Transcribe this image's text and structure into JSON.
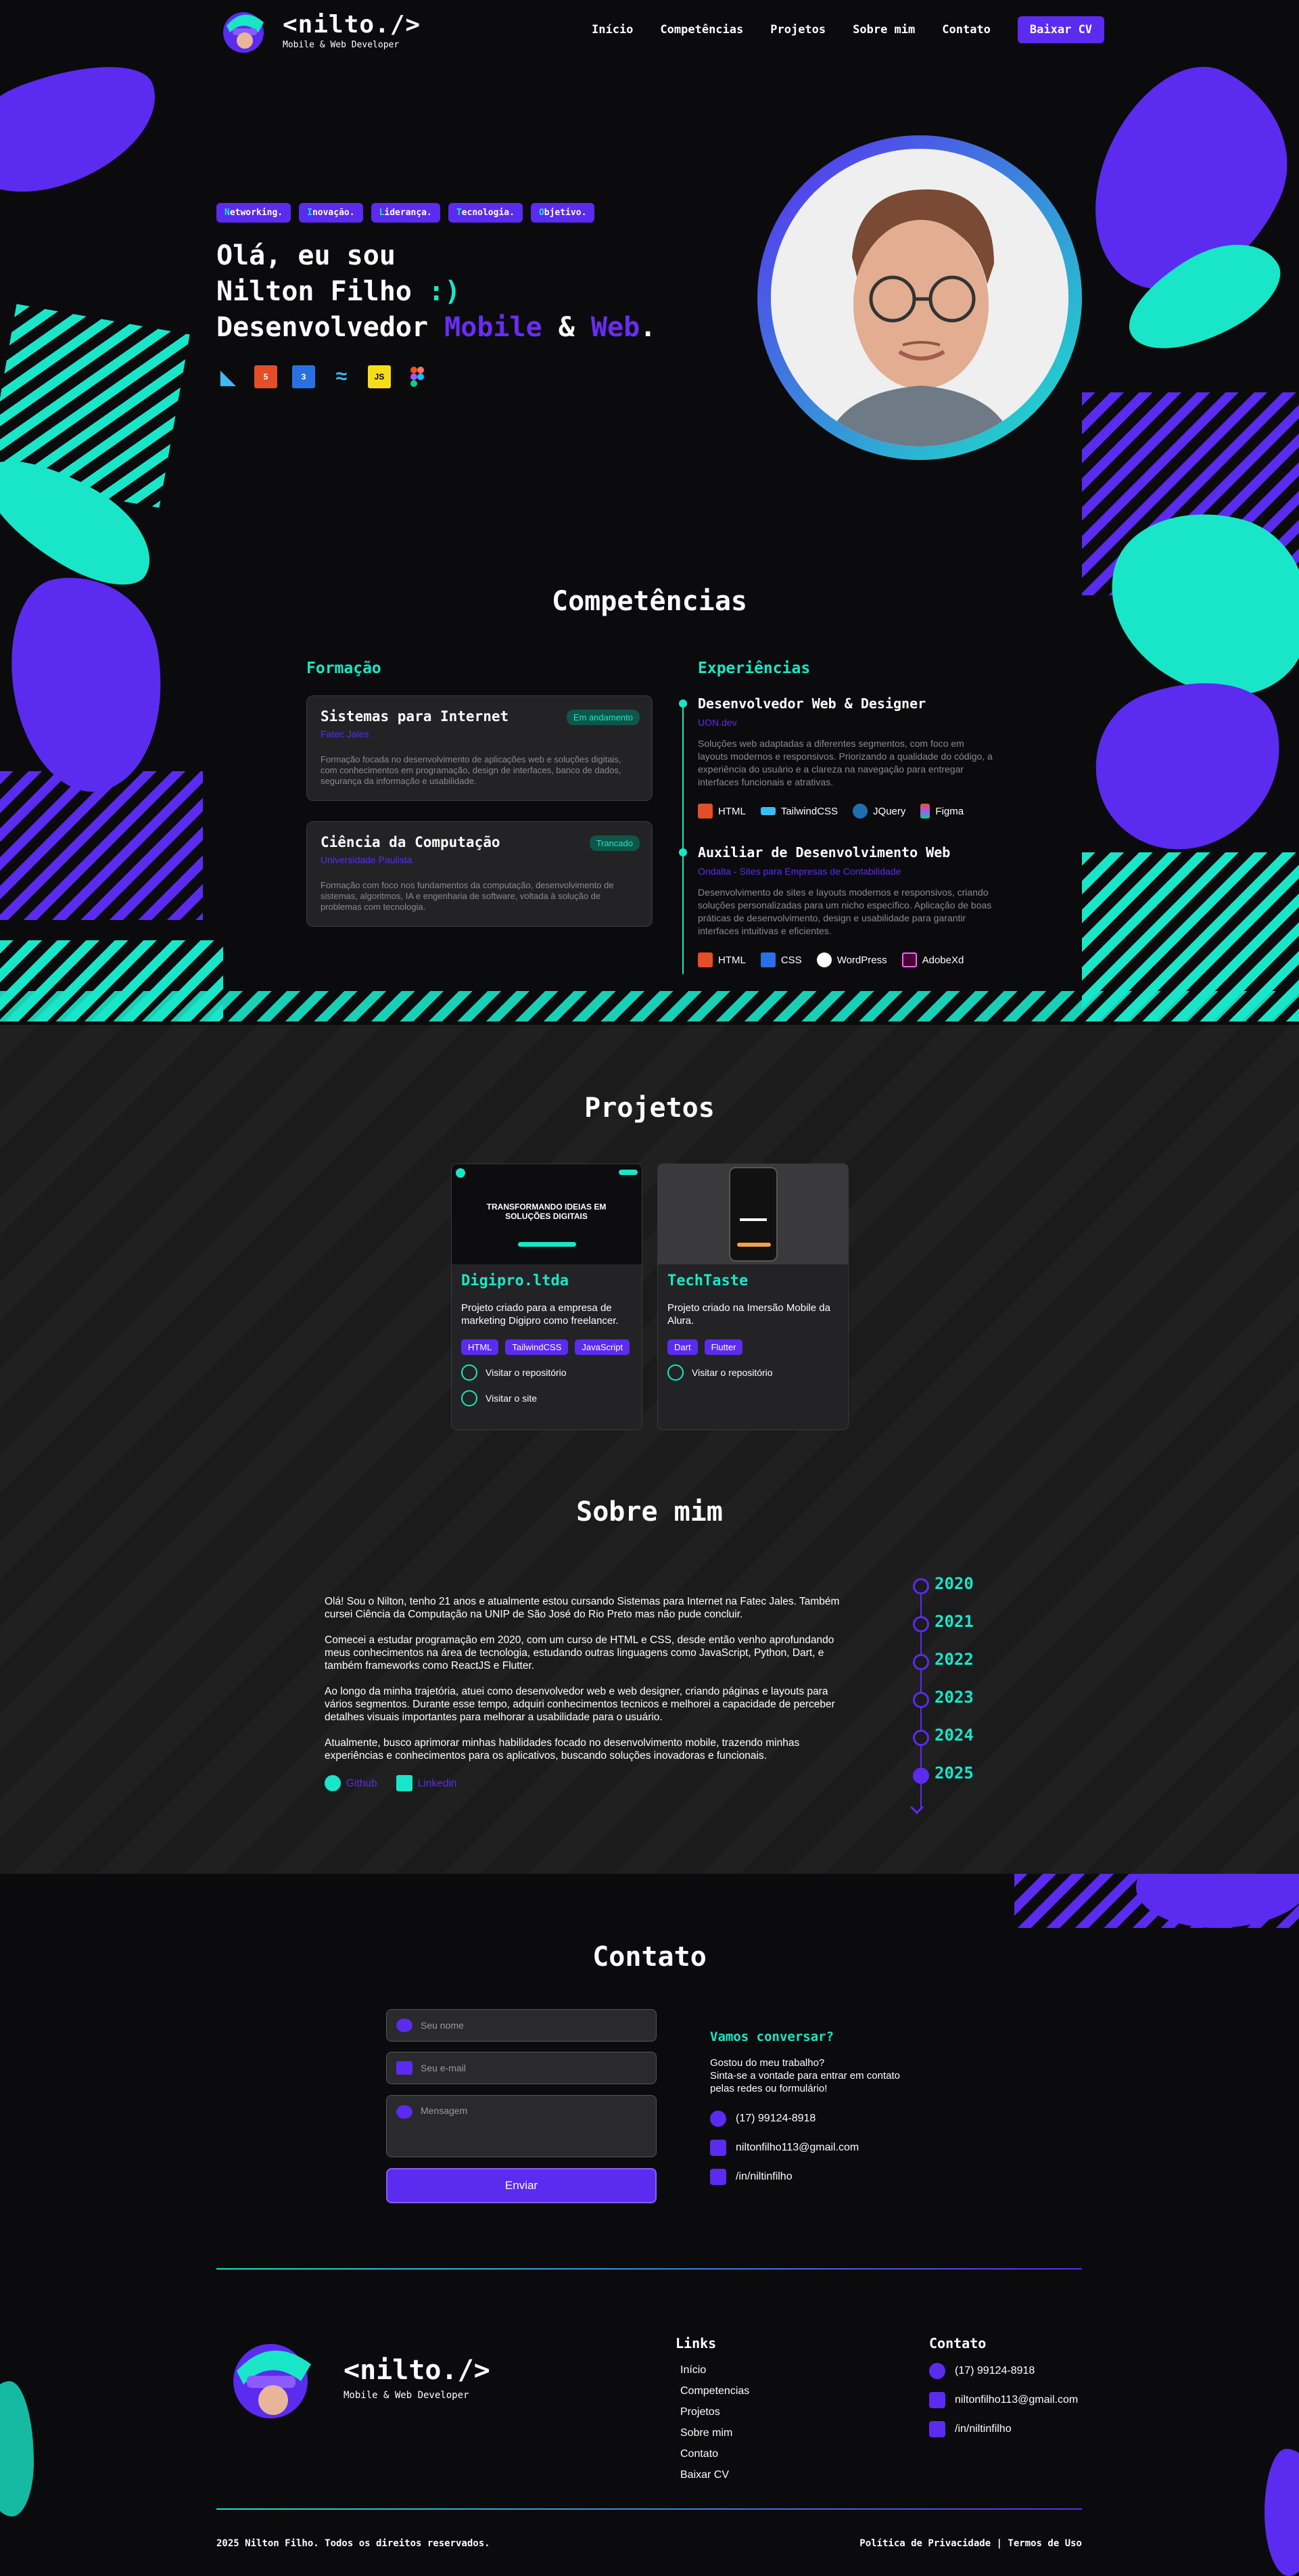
{
  "brand": {
    "name": "<nilto./>",
    "subtitle": "Mobile & Web Developer"
  },
  "nav": {
    "items": [
      "Início",
      "Competências",
      "Projetos",
      "Sobre mim",
      "Contato"
    ],
    "cta": "Baixar CV"
  },
  "hero": {
    "tags": [
      {
        "first": "N",
        "rest": "etworking."
      },
      {
        "first": "I",
        "rest": "novação."
      },
      {
        "first": "L",
        "rest": "iderança."
      },
      {
        "first": "T",
        "rest": "ecnologia."
      },
      {
        "first": "O",
        "rest": "bjetivo."
      }
    ],
    "line1": "Olá, eu sou",
    "line2_name": "Nilton Filho ",
    "line2_smile": ":)",
    "line3_prefix": "Desenvolvedor ",
    "line3_mobile": "Mobile",
    "line3_amp": " & ",
    "line3_web": "Web",
    "line3_dot": ".",
    "tech_icons": [
      "flutter-icon",
      "html5-icon",
      "css3-icon",
      "tailwind-icon",
      "javascript-icon",
      "figma-icon"
    ]
  },
  "competencias": {
    "title": "Competências",
    "formacao_title": "Formação",
    "experiencias_title": "Experiências",
    "formacao": [
      {
        "course": "Sistemas para Internet",
        "institution": "Fatec Jales",
        "status": "Em andamento",
        "desc": "Formação focada no desenvolvimento de aplicações web e soluções digitais, com conhecimentos em programação, design de interfaces, banco de dados, segurança da informação e usabilidade."
      },
      {
        "course": "Ciência da Computação",
        "institution": "Universidade Paulista",
        "status": "Trancado",
        "desc": "Formação com foco nos fundamentos da computação, desenvolvimento de sistemas, algoritmos, IA e engenharia de software, voltada à solução de problemas com tecnologia."
      }
    ],
    "experiencias": [
      {
        "role": "Desenvolvedor Web & Designer",
        "company": "UON.dev",
        "desc": "Soluções web adaptadas a diferentes segmentos, com foco em layouts modernos e responsivos. Priorizando a qualidade do código, a experiência do usuário e a clareza na navegação para entregar interfaces funcionais e atrativas.",
        "skills": [
          "HTML",
          "TailwindCSS",
          "JQuery",
          "Figma"
        ]
      },
      {
        "role": "Auxiliar de Desenvolvimento Web",
        "company": "Ondalta - Sites para Empresas de Contabilidade",
        "desc": "Desenvolvimento de sites e layouts modernos e responsivos, criando soluções personalizadas para um nicho específico. Aplicação de boas práticas de desenvolvimento, design e usabilidade para garantir interfaces intuitivas e eficientes.",
        "skills": [
          "HTML",
          "CSS",
          "WordPress",
          "AdobeXd"
        ]
      }
    ]
  },
  "projetos": {
    "title": "Projetos",
    "items": [
      {
        "name": "Digipro.ltda",
        "desc": "Projeto criado para a empresa de marketing Digipro como freelancer.",
        "tags": [
          "HTML",
          "TailwindCSS",
          "JavaScript"
        ],
        "repo": "Visitar o repositório",
        "site": "Visitar o site",
        "thumb_heading": "TRANSFORMANDO IDEIAS EM SOLUÇÕES DIGITAIS"
      },
      {
        "name": "TechTaste",
        "desc": "Projeto criado na Imersão Mobile da Alura.",
        "tags": [
          "Dart",
          "Flutter"
        ],
        "repo": "Visitar o repositório"
      }
    ]
  },
  "sobre": {
    "title": "Sobre mim",
    "paragraphs": [
      "Olá! Sou o Nilton, tenho 21 anos e atualmente estou cursando Sistemas para Internet na Fatec Jales. Também cursei Ciência da Computação na UNIP de São José do Rio Preto  mas não pude concluir.",
      "Comecei a estudar programação em 2020, com um curso de HTML e CSS, desde então venho aprofundando meus conhecimentos na área de tecnologia, estudando outras linguagens como JavaScript, Python, Dart, e também frameworks como ReactJS e Flutter.",
      "Ao longo da minha trajetória, atuei como desenvolvedor web e web designer, criando páginas e layouts para vários segmentos. Durante esse tempo, adquiri conhecimentos tecnicos e melhorei a capacidade de perceber detalhes visuais importantes para melhorar a usabilidade para o usuário.",
      "Atualmente,  busco aprimorar minhas habilidades focado no desenvolvimento mobile, trazendo minhas experiências e conhecimentos para os aplicativos, buscando soluções inovadoras e funcionais."
    ],
    "links": [
      "Github",
      "Linkedin"
    ],
    "years": [
      "2020",
      "2021",
      "2022",
      "2023",
      "2024",
      "2025"
    ]
  },
  "contato": {
    "title": "Contato",
    "placeholders": {
      "name": "Seu nome",
      "email": "Seu e-mail",
      "message": "Mensagem"
    },
    "send": "Enviar",
    "heading": "Vamos conversar?",
    "intro": [
      "Gostou do meu trabalho?",
      "Sinta-se a vontade para entrar em contato",
      "pelas redes ou formulário!"
    ],
    "phone": "(17) 99124-8918",
    "email": "niltonfilho113@gmail.com",
    "linkedin": "/in/niltinfilho"
  },
  "footer": {
    "links_title": "Links",
    "links": [
      "Início",
      "Competencias",
      "Projetos",
      "Sobre mim",
      "Contato",
      "Baixar CV"
    ],
    "contact_title": "Contato",
    "phone": "(17) 99124-8918",
    "email": "niltonfilho113@gmail.com",
    "linkedin": "/in/niltinfilho",
    "copyright": "2025 Nilton Filho. Todos os direitos reservados.",
    "policy": "Política de Privacidade | Termos de Uso"
  },
  "colors": {
    "purple": "#5b2bf0",
    "teal": "#19e6c8",
    "bg": "#0b0b0d",
    "card": "#232325"
  }
}
